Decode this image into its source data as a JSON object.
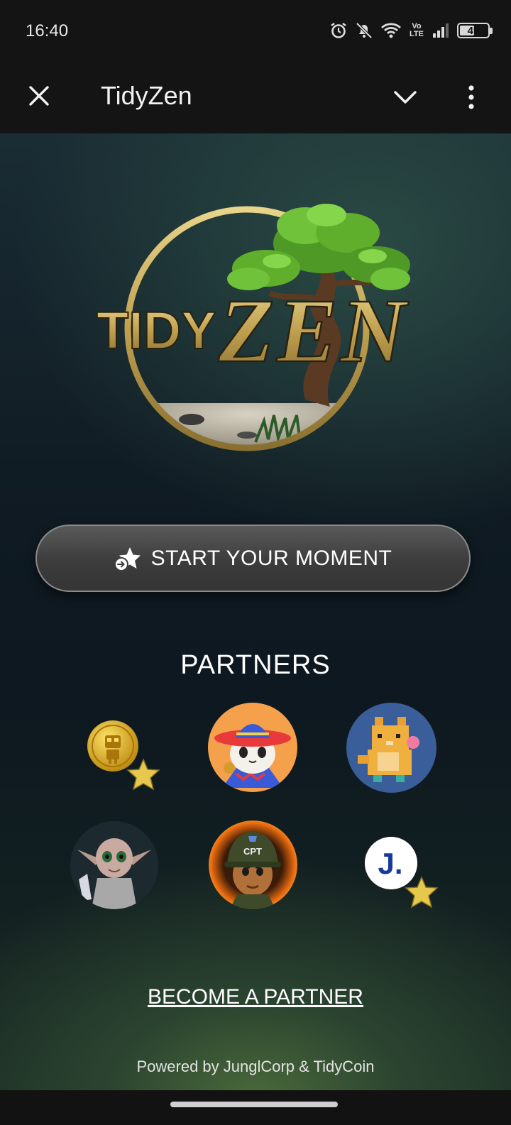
{
  "status_bar": {
    "time": "16:40",
    "network": "VoLTE",
    "network_line1": "Vo",
    "network_line2": "LTE",
    "battery": "49",
    "icons": [
      "alarm-icon",
      "bell-off-icon",
      "wifi-icon",
      "volte-icon",
      "signal-icon",
      "battery-icon"
    ]
  },
  "app_bar": {
    "title": "TidyZen",
    "close_icon": "close-icon",
    "collapse_icon": "chevron-down-icon",
    "menu_icon": "more-vert-icon"
  },
  "logo": {
    "text_tidy": "TIDY",
    "text_zen": "ZEN",
    "colors": {
      "gold": "#c9b06a",
      "tree_green": "#5fae2c",
      "trunk": "#5a3a22"
    }
  },
  "main": {
    "start_button_label": "START YOUR MOMENT",
    "start_icon": "star-enter-icon",
    "partners_title": "PARTNERS",
    "partners": [
      {
        "name": "gold-robot-coin",
        "icon": "gold-coin-icon",
        "starred": true
      },
      {
        "name": "sombrero-cat",
        "icon": "sombrero-cat-avatar",
        "starred": false
      },
      {
        "name": "pixel-shiba",
        "icon": "pixel-dog-avatar",
        "starred": false
      },
      {
        "name": "elf-character",
        "icon": "elf-avatar",
        "starred": false
      },
      {
        "name": "cpt-soldier",
        "icon": "soldier-avatar",
        "badge_text": "CPT",
        "starred": false
      },
      {
        "name": "j-logo",
        "icon": "j-letter-icon",
        "badge_text": "J.",
        "starred": true
      }
    ],
    "become_partner_label": "BECOME A PARTNER",
    "powered_by": "Powered by JunglCorp & TidyCoin"
  },
  "colors": {
    "accent_gold": "#d8b94a",
    "button_bg": "#3e3e3e",
    "background_top": "#1a2c34",
    "background_bottom": "#4a6a3a"
  }
}
